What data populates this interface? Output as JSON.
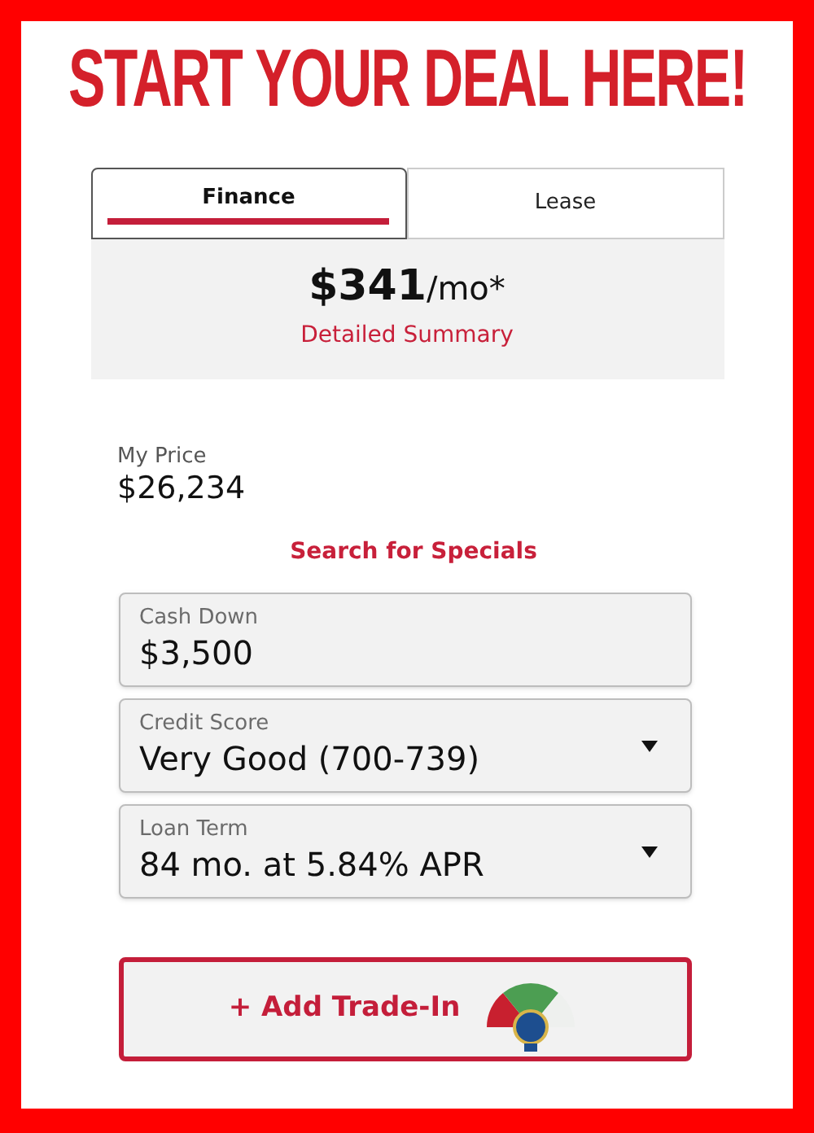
{
  "title": "START YOUR DEAL HERE!",
  "tabs": [
    {
      "label": "Finance",
      "selected": true
    },
    {
      "label": "Lease",
      "selected": false
    }
  ],
  "payment": {
    "amount": "$341",
    "unit": "/mo*",
    "link": "Detailed Summary"
  },
  "price": {
    "label": "My Price",
    "value": "$26,234"
  },
  "specials_link": "Search for Specials",
  "fields": [
    {
      "kind": "text",
      "label": "Cash Down",
      "value": "$3,500"
    },
    {
      "kind": "select",
      "label": "Credit Score",
      "value": "Very Good (700-739)"
    },
    {
      "kind": "select",
      "label": "Loan Term",
      "value": "84 mo. at 5.84% APR"
    }
  ],
  "trade_in_button": "+ Add Trade-In"
}
